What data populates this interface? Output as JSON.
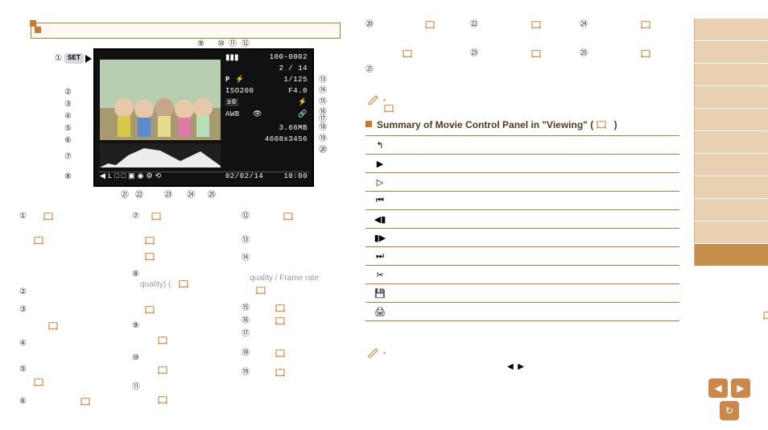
{
  "display": {
    "folder_file": "100-0002",
    "counter": "2 / 14",
    "mode": "P",
    "shutter": "1/125",
    "iso": "ISO200",
    "aperture": "F4.0",
    "exp_comp": "±0",
    "flash_icon": "⚡",
    "awb": "AWB",
    "face_lock": "👁",
    "link": "🔗",
    "size": "3.66MB",
    "resolution": "4608x3456",
    "date": "02/02/14",
    "time": "10:00",
    "bottom_icons": [
      "◀",
      "L",
      "◻",
      "◻",
      "⬒",
      "◉",
      "⚙",
      "⟲"
    ],
    "set_label": "SET",
    "flash_exp": "⚡",
    "battery": "▮▮▮"
  },
  "callouts": {
    "top": [
      "⑨",
      "⑩",
      "⑪",
      "⑫"
    ],
    "left": [
      "①",
      "②",
      "③",
      "④",
      "⑤",
      "⑥",
      "⑦",
      "⑧"
    ],
    "right": [
      "⑬",
      "⑭",
      "⑮",
      "⑯",
      "⑰",
      "⑱",
      "⑲",
      "⑳"
    ],
    "bottom": [
      "㉑",
      "㉒",
      "㉓",
      "㉔",
      "㉕"
    ]
  },
  "legend_cols": {
    "col1": [
      "①",
      "②",
      "③",
      "④",
      "⑤",
      "⑥"
    ],
    "col2": [
      "⑦",
      "⑧",
      "⑨",
      "⑩",
      "⑪"
    ],
    "col3": [
      "⑫",
      "⑬",
      "⑭",
      "⑮",
      "⑯",
      "⑰",
      "⑱",
      "⑲"
    ],
    "col2_text_quality": "quality) (",
    "col3_text_rate": "quality / Frame rate"
  },
  "legend_block_right": [
    "⑳",
    "㉑",
    "㉒",
    "㉓",
    "㉔",
    "㉕"
  ],
  "heading": "Summary of Movie Control Panel in \"Viewing\" (",
  "heading_close": ")",
  "table": [
    {
      "glyph": "↰",
      "symbols": []
    },
    {
      "glyph": "▶",
      "symbols": []
    },
    {
      "glyph": "▷",
      "symbols": [
        "tri-pair"
      ]
    },
    {
      "glyph": "⏮",
      "symbols": [
        "qr"
      ]
    },
    {
      "glyph": "◀▮",
      "symbols": [
        "qr-right"
      ]
    },
    {
      "glyph": "▮▶",
      "symbols": [
        "qr-right"
      ]
    },
    {
      "glyph": "⏭",
      "symbols": [
        "qr-center",
        "book"
      ]
    },
    {
      "glyph": "✂",
      "symbols": [
        "book-left"
      ]
    },
    {
      "glyph": "💾",
      "symbols": [
        "book-right"
      ]
    },
    {
      "glyph": "🖨",
      "symbols": [
        "book-left"
      ]
    }
  ],
  "nav": {
    "prev": "◀",
    "next": "▶",
    "home": "↻"
  }
}
